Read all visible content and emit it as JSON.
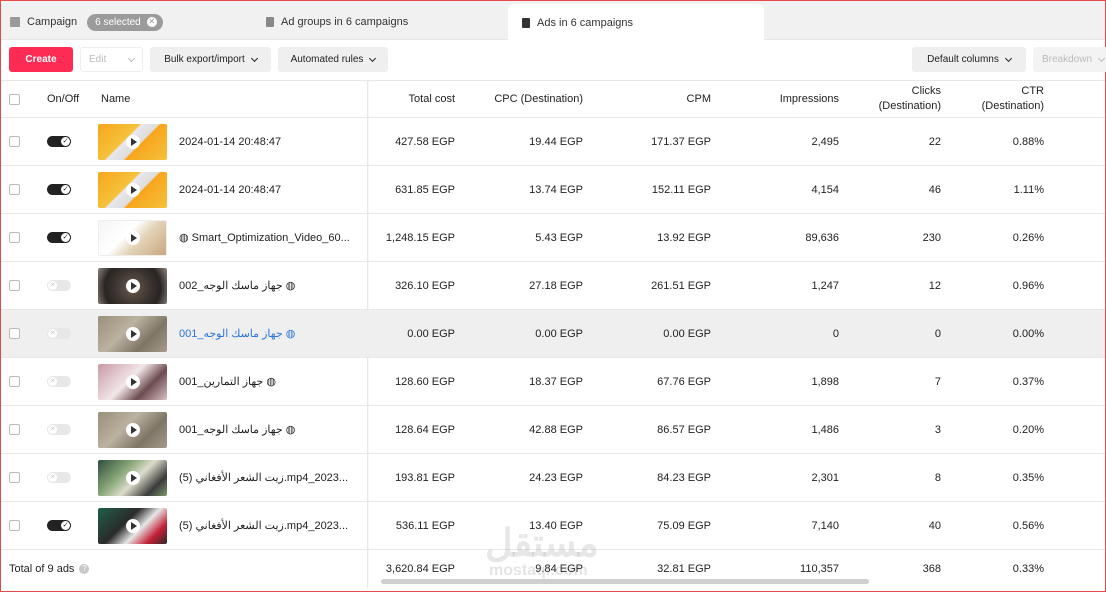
{
  "tabs": {
    "campaign_label": "Campaign",
    "selected_pill": "6 selected",
    "ad_groups_label": "Ad groups in 6 campaigns",
    "ads_label": "Ads in 6 campaigns"
  },
  "toolbar": {
    "create": "Create",
    "edit": "Edit",
    "bulk": "Bulk export/import",
    "rules": "Automated rules",
    "columns": "Default columns",
    "breakdown": "Breakdown"
  },
  "table": {
    "headers": {
      "onoff": "On/Off",
      "name": "Name",
      "cost": "Total cost",
      "cpc": "CPC (Destination)",
      "cpm": "CPM",
      "impressions": "Impressions",
      "clicks": "Clicks (Destination)",
      "ctr": "CTR (Destination)"
    },
    "rows": [
      {
        "on": true,
        "thumb": "orange",
        "name": "2024-01-14 20:48:47",
        "cost": "427.58 EGP",
        "cpc": "19.44 EGP",
        "cpm": "171.37 EGP",
        "impressions": "2,495",
        "clicks": "22",
        "ctr": "0.88%"
      },
      {
        "on": true,
        "thumb": "orange",
        "name": "2024-01-14 20:48:47",
        "cost": "631.85 EGP",
        "cpc": "13.74 EGP",
        "cpm": "152.11 EGP",
        "impressions": "4,154",
        "clicks": "46",
        "ctr": "1.11%"
      },
      {
        "on": true,
        "thumb": "white",
        "name": "◍ Smart_Optimization_Video_60...",
        "cost": "1,248.15 EGP",
        "cpc": "5.43 EGP",
        "cpm": "13.92 EGP",
        "impressions": "89,636",
        "clicks": "230",
        "ctr": "0.26%"
      },
      {
        "on": false,
        "thumb": "dark",
        "name": "جهاز ماسك الوجه_002 ◍",
        "cost": "326.10 EGP",
        "cpc": "27.18 EGP",
        "cpm": "261.51 EGP",
        "impressions": "1,247",
        "clicks": "12",
        "ctr": "0.96%"
      },
      {
        "on": false,
        "thumb": "stone",
        "name": "جهاز ماسك الوجه_001 ◍",
        "cost": "0.00 EGP",
        "cpc": "0.00 EGP",
        "cpm": "0.00 EGP",
        "impressions": "0",
        "clicks": "0",
        "ctr": "0.00%"
      },
      {
        "on": false,
        "thumb": "pink",
        "name": "جهاز التمارين_001 ◍",
        "cost": "128.60 EGP",
        "cpc": "18.37 EGP",
        "cpm": "67.76 EGP",
        "impressions": "1,898",
        "clicks": "7",
        "ctr": "0.37%"
      },
      {
        "on": false,
        "thumb": "stone",
        "name": "جهاز ماسك الوجه_001 ◍",
        "cost": "128.64 EGP",
        "cpc": "42.88 EGP",
        "cpm": "86.57 EGP",
        "impressions": "1,486",
        "clicks": "3",
        "ctr": "0.20%"
      },
      {
        "on": false,
        "thumb": "green",
        "name": "(5) زيت الشعر الأفغاني.mp4_2023...",
        "cost": "193.81 EGP",
        "cpc": "24.23 EGP",
        "cpm": "84.23 EGP",
        "impressions": "2,301",
        "clicks": "8",
        "ctr": "0.35%"
      },
      {
        "on": true,
        "thumb": "poster",
        "name": "(5) زيت الشعر الأفغاني.mp4_2023...",
        "cost": "536.11 EGP",
        "cpc": "13.40 EGP",
        "cpm": "75.09 EGP",
        "impressions": "7,140",
        "clicks": "40",
        "ctr": "0.56%"
      }
    ],
    "total": {
      "label": "Total of 9 ads",
      "cost": "3,620.84 EGP",
      "cpc": "9.84 EGP",
      "cpm": "32.81 EGP",
      "impressions": "110,357",
      "clicks": "368",
      "ctr": "0.33%"
    }
  },
  "watermark": {
    "main": "مستقل",
    "sub": "mostaql.com"
  }
}
